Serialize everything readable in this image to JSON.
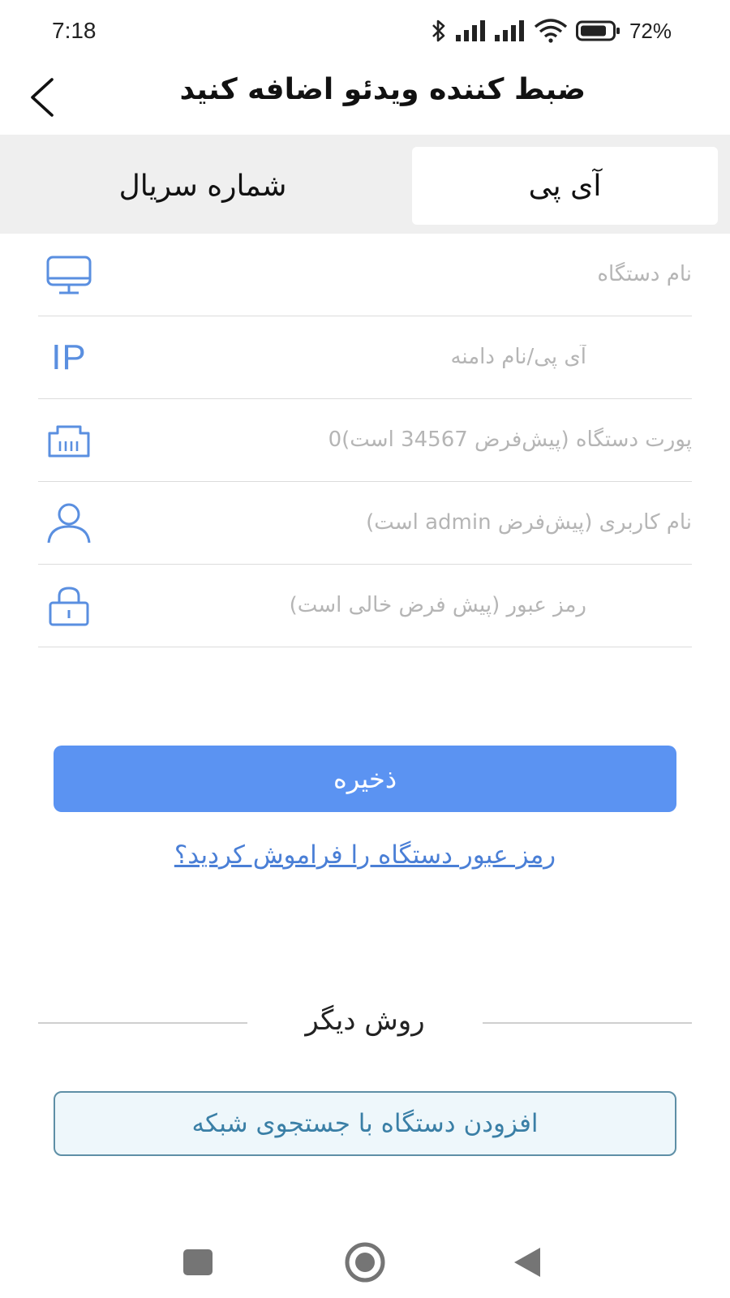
{
  "status_bar": {
    "time": "7:18",
    "battery_percent": "72%",
    "icons": [
      "bluetooth-icon",
      "signal-icon",
      "signal-icon",
      "wifi-icon",
      "battery-icon"
    ]
  },
  "header": {
    "title": "ضبط کننده ویدئو اضافه کنید",
    "back_icon": "chevron-left-icon"
  },
  "tabs": [
    {
      "label": "آی پی",
      "selected": true
    },
    {
      "label": "شماره سریال",
      "selected": false
    }
  ],
  "form": {
    "device_name": {
      "placeholder": "نام دستگاه",
      "value": "",
      "icon": "monitor-icon"
    },
    "ip_domain": {
      "placeholder": "آی پی/نام دامنه",
      "value": "",
      "icon": "ip-icon",
      "icon_text": "IP"
    },
    "port": {
      "placeholder": "پورت دستگاه (پیش‌فرض 34567 است)0",
      "value": "",
      "icon": "ethernet-port-icon"
    },
    "username": {
      "placeholder": "نام کاربری (پیش‌فرض admin است)",
      "value": "",
      "icon": "user-icon"
    },
    "password": {
      "placeholder": "رمز عبور (پیش فرض خالی است)",
      "value": "",
      "icon": "lock-icon"
    }
  },
  "actions": {
    "save_label": "ذخیره",
    "forgot_password_label": "رمز عبور دستگاه را فراموش کردید؟",
    "other_method_label": "روش دیگر",
    "network_search_label": "افزودن دستگاه با جستجوی شبکه"
  },
  "navigation_bar": {
    "buttons": [
      "recent-apps-icon",
      "home-icon",
      "back-triangle-icon"
    ]
  },
  "colors": {
    "accent": "#5b93f2",
    "icon_blue": "#5a8fe0",
    "link": "#4a7fd6",
    "tab_bg": "#efefef",
    "secondary_button_border": "#5e8fa6",
    "secondary_button_bg": "#eef7fb"
  }
}
